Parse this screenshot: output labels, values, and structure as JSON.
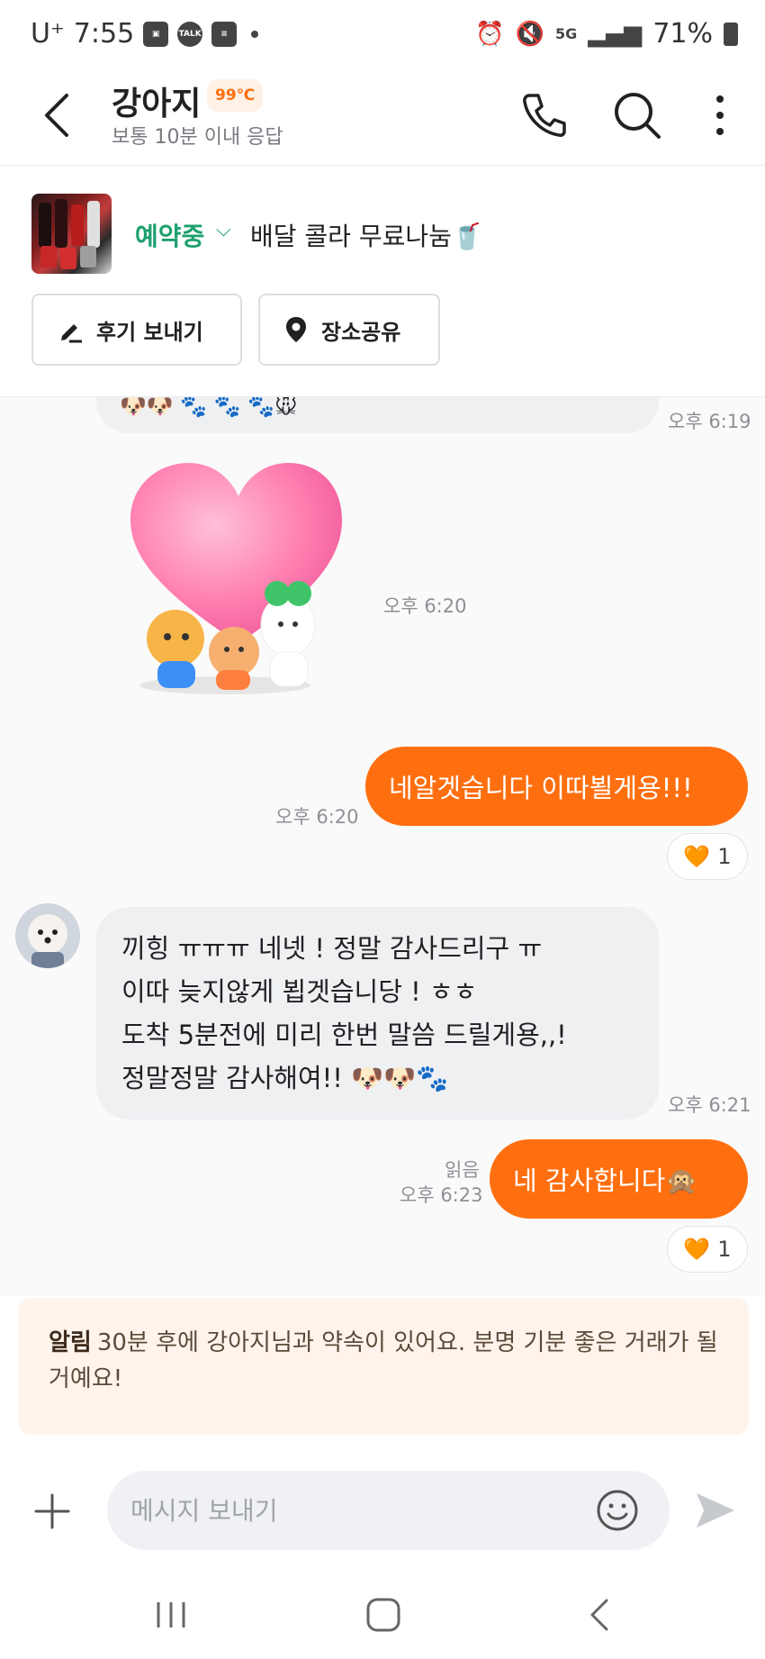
{
  "status_bar": {
    "carrier": "U⁺",
    "time": "7:55",
    "battery": "71%"
  },
  "header": {
    "title": "강아지",
    "temperature": "99℃",
    "subtitle": "보통 10분 이내 응답"
  },
  "product": {
    "status": "예약중",
    "title": "배달 콜라 무료나눔🥤",
    "review_button": "후기 보내기",
    "share_location_button": "장소공유"
  },
  "chat": {
    "partial_message_emoji": "🐶🐶 🐾 🐾 🐾🐭",
    "partial_message_time": "오후 6:19",
    "sticker_time": "오후 6:20",
    "msg1": {
      "text": "네알겟습니다 이따뵐게용!!!",
      "time": "오후 6:20",
      "reaction_emoji": "🧡",
      "reaction_count": "1"
    },
    "msg2": {
      "lines": [
        "끼힝 ㅠㅠㅠ 네넷 ! 정말 감사드리구 ㅠ",
        "이따 늦지않게 뵙겟습니당 ! ㅎㅎ",
        "도착 5분전에 미리 한번 말씀 드릴게용,,!",
        "정말정말 감사해여!! 🐶🐶🐾"
      ],
      "time": "오후 6:21"
    },
    "msg3": {
      "text": "네 감사합니다🙊",
      "read": "읽음",
      "time": "오후 6:23",
      "reaction_emoji": "🧡",
      "reaction_count": "1"
    }
  },
  "notice": {
    "label": "알림",
    "text": "30분 후에 강아지님과 약속이 있어요. 분명 기분 좋은 거래가 될 거예요!"
  },
  "input": {
    "placeholder": "메시지 보내기"
  },
  "colors": {
    "accent": "#ff6f0f",
    "reserved_green": "#1ea06e",
    "incoming_bubble": "#eef0f2",
    "notice_bg": "#fff4eb"
  }
}
